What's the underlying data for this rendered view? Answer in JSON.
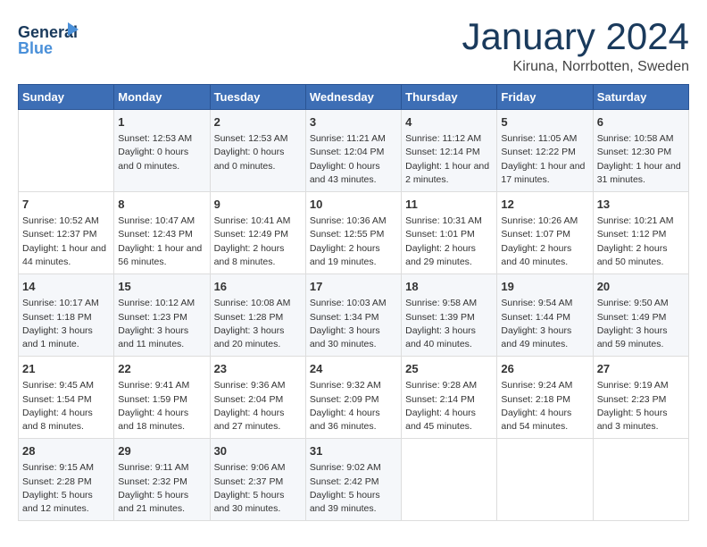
{
  "header": {
    "logo_line1": "General",
    "logo_line2": "Blue",
    "month": "January 2024",
    "location": "Kiruna, Norrbotten, Sweden"
  },
  "weekdays": [
    "Sunday",
    "Monday",
    "Tuesday",
    "Wednesday",
    "Thursday",
    "Friday",
    "Saturday"
  ],
  "weeks": [
    [
      {
        "day": "",
        "text": ""
      },
      {
        "day": "1",
        "text": "Sunset: 12:53 AM\nDaylight: 0 hours\nand 0 minutes."
      },
      {
        "day": "2",
        "text": "Sunset: 12:53 AM\nDaylight: 0 hours\nand 0 minutes."
      },
      {
        "day": "3",
        "text": "Sunrise: 11:21 AM\nSunset: 12:04 PM\nDaylight: 0 hours\nand 43 minutes."
      },
      {
        "day": "4",
        "text": "Sunrise: 11:12 AM\nSunset: 12:14 PM\nDaylight: 1 hour and\n2 minutes."
      },
      {
        "day": "5",
        "text": "Sunrise: 11:05 AM\nSunset: 12:22 PM\nDaylight: 1 hour and\n17 minutes."
      },
      {
        "day": "6",
        "text": "Sunrise: 10:58 AM\nSunset: 12:30 PM\nDaylight: 1 hour and\n31 minutes."
      }
    ],
    [
      {
        "day": "7",
        "text": "Sunrise: 10:52 AM\nSunset: 12:37 PM\nDaylight: 1 hour and\n44 minutes."
      },
      {
        "day": "8",
        "text": "Sunrise: 10:47 AM\nSunset: 12:43 PM\nDaylight: 1 hour and\n56 minutes."
      },
      {
        "day": "9",
        "text": "Sunrise: 10:41 AM\nSunset: 12:49 PM\nDaylight: 2 hours\nand 8 minutes."
      },
      {
        "day": "10",
        "text": "Sunrise: 10:36 AM\nSunset: 12:55 PM\nDaylight: 2 hours\nand 19 minutes."
      },
      {
        "day": "11",
        "text": "Sunrise: 10:31 AM\nSunset: 1:01 PM\nDaylight: 2 hours\nand 29 minutes."
      },
      {
        "day": "12",
        "text": "Sunrise: 10:26 AM\nSunset: 1:07 PM\nDaylight: 2 hours\nand 40 minutes."
      },
      {
        "day": "13",
        "text": "Sunrise: 10:21 AM\nSunset: 1:12 PM\nDaylight: 2 hours\nand 50 minutes."
      }
    ],
    [
      {
        "day": "14",
        "text": "Sunrise: 10:17 AM\nSunset: 1:18 PM\nDaylight: 3 hours\nand 1 minute."
      },
      {
        "day": "15",
        "text": "Sunrise: 10:12 AM\nSunset: 1:23 PM\nDaylight: 3 hours\nand 11 minutes."
      },
      {
        "day": "16",
        "text": "Sunrise: 10:08 AM\nSunset: 1:28 PM\nDaylight: 3 hours\nand 20 minutes."
      },
      {
        "day": "17",
        "text": "Sunrise: 10:03 AM\nSunset: 1:34 PM\nDaylight: 3 hours\nand 30 minutes."
      },
      {
        "day": "18",
        "text": "Sunrise: 9:58 AM\nSunset: 1:39 PM\nDaylight: 3 hours\nand 40 minutes."
      },
      {
        "day": "19",
        "text": "Sunrise: 9:54 AM\nSunset: 1:44 PM\nDaylight: 3 hours\nand 49 minutes."
      },
      {
        "day": "20",
        "text": "Sunrise: 9:50 AM\nSunset: 1:49 PM\nDaylight: 3 hours\nand 59 minutes."
      }
    ],
    [
      {
        "day": "21",
        "text": "Sunrise: 9:45 AM\nSunset: 1:54 PM\nDaylight: 4 hours\nand 8 minutes."
      },
      {
        "day": "22",
        "text": "Sunrise: 9:41 AM\nSunset: 1:59 PM\nDaylight: 4 hours\nand 18 minutes."
      },
      {
        "day": "23",
        "text": "Sunrise: 9:36 AM\nSunset: 2:04 PM\nDaylight: 4 hours\nand 27 minutes."
      },
      {
        "day": "24",
        "text": "Sunrise: 9:32 AM\nSunset: 2:09 PM\nDaylight: 4 hours\nand 36 minutes."
      },
      {
        "day": "25",
        "text": "Sunrise: 9:28 AM\nSunset: 2:14 PM\nDaylight: 4 hours\nand 45 minutes."
      },
      {
        "day": "26",
        "text": "Sunrise: 9:24 AM\nSunset: 2:18 PM\nDaylight: 4 hours\nand 54 minutes."
      },
      {
        "day": "27",
        "text": "Sunrise: 9:19 AM\nSunset: 2:23 PM\nDaylight: 5 hours\nand 3 minutes."
      }
    ],
    [
      {
        "day": "28",
        "text": "Sunrise: 9:15 AM\nSunset: 2:28 PM\nDaylight: 5 hours\nand 12 minutes."
      },
      {
        "day": "29",
        "text": "Sunrise: 9:11 AM\nSunset: 2:32 PM\nDaylight: 5 hours\nand 21 minutes."
      },
      {
        "day": "30",
        "text": "Sunrise: 9:06 AM\nSunset: 2:37 PM\nDaylight: 5 hours\nand 30 minutes."
      },
      {
        "day": "31",
        "text": "Sunrise: 9:02 AM\nSunset: 2:42 PM\nDaylight: 5 hours\nand 39 minutes."
      },
      {
        "day": "",
        "text": ""
      },
      {
        "day": "",
        "text": ""
      },
      {
        "day": "",
        "text": ""
      }
    ]
  ]
}
